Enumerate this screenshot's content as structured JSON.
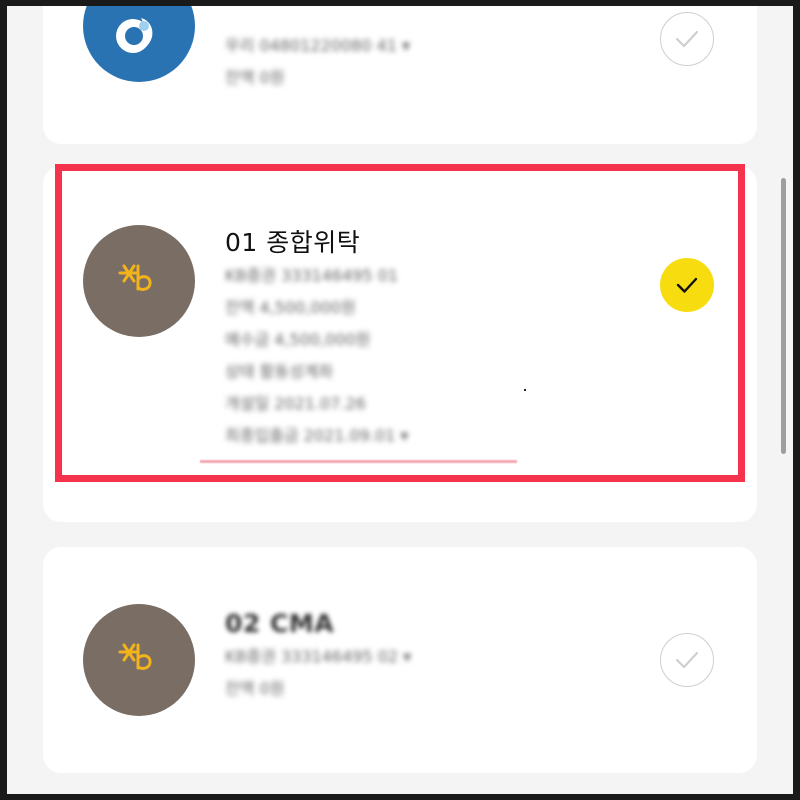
{
  "colors": {
    "highlight": "#f5334c",
    "check_active": "#f7dc10",
    "kb_logo_bg": "#7a6e64",
    "kb_logo_fg": "#f2b31b",
    "bank_logo_bg": "#2a73b3"
  },
  "accounts": [
    {
      "title": "",
      "lines": [
        "우리 04801220080 41 ▾",
        "잔액 0원"
      ],
      "logo_icon": "bank-logo-icon",
      "selected": false
    },
    {
      "title": "01 종합위탁",
      "lines": [
        "KB증권 333146495 01",
        "잔액 4,500,000원",
        "예수금 4,500,000원",
        "상태 활동성계좌",
        "개설일 2021.07.26",
        "최종입출금 2021.09.01 ▾"
      ],
      "logo_icon": "kb-logo-icon",
      "selected": true
    },
    {
      "title": "02 CMA",
      "lines": [
        "KB증권 333146495 02 ▾",
        "잔액 0원"
      ],
      "logo_icon": "kb-logo-icon",
      "selected": false
    }
  ]
}
